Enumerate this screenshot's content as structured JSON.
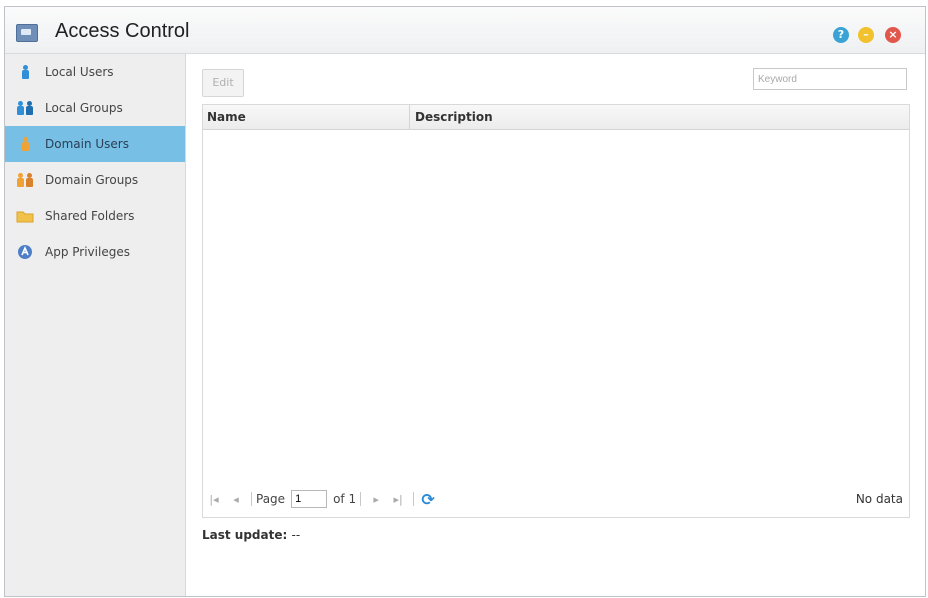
{
  "window": {
    "title": "Access Control"
  },
  "sidebar": {
    "items": [
      {
        "label": "Local Users",
        "icon": "user-icon",
        "color": "#2f8fd8",
        "active": false
      },
      {
        "label": "Local Groups",
        "icon": "group-icon",
        "color": "#2f8fd8",
        "active": false
      },
      {
        "label": "Domain Users",
        "icon": "domain-user-icon",
        "color": "#f0a234",
        "active": true
      },
      {
        "label": "Domain Groups",
        "icon": "domain-group-icon",
        "color": "#f0a234",
        "active": false
      },
      {
        "label": "Shared Folders",
        "icon": "folder-icon",
        "color": "#f2c14a",
        "active": false
      },
      {
        "label": "App Privileges",
        "icon": "app-privileges-icon",
        "color": "#4d7fc9",
        "active": false
      }
    ]
  },
  "toolbar": {
    "edit_label": "Edit",
    "search_placeholder": "Keyword"
  },
  "grid": {
    "columns": [
      "Name",
      "Description"
    ],
    "rows": []
  },
  "pager": {
    "page_label": "Page",
    "page_value": "1",
    "of_label": "of 1",
    "status": "No data"
  },
  "footer": {
    "last_update_label": "Last update:",
    "last_update_value": "--"
  },
  "colors": {
    "active_item": "#78bfe6",
    "help": "#3aa3d6",
    "minimize": "#f2c12e",
    "close": "#e2574c"
  }
}
